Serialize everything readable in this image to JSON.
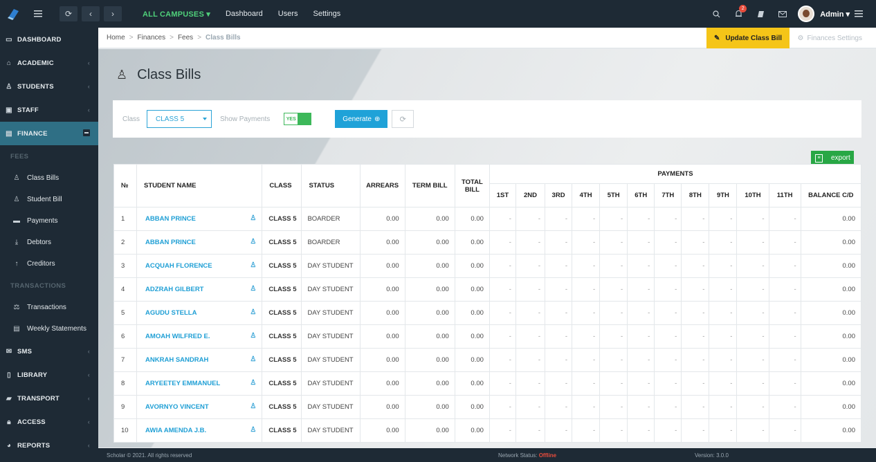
{
  "topbar": {
    "campus": "ALL CAMPUSES",
    "links": [
      "Dashboard",
      "Users",
      "Settings"
    ],
    "notif_count": "2",
    "user": "Admin"
  },
  "sidebar": {
    "items": [
      {
        "label": "DASHBOARD",
        "icon": "monitor-icon"
      },
      {
        "label": "ACADEMIC",
        "icon": "graduation-cap-icon"
      },
      {
        "label": "STUDENTS",
        "icon": "user-icon"
      },
      {
        "label": "STAFF",
        "icon": "briefcase-icon"
      },
      {
        "label": "FINANCE",
        "icon": "money-icon"
      }
    ],
    "fees_section": "FEES",
    "fees_items": [
      "Class Bills",
      "Student Bill",
      "Payments",
      "Debtors",
      "Creditors"
    ],
    "transactions_section": "TRANSACTIONS",
    "transactions_items": [
      "Transactions",
      "Weekly Statements"
    ],
    "bottom_items": [
      "SMS",
      "LIBRARY",
      "TRANSPORT",
      "ACCESS",
      "REPORTS"
    ]
  },
  "breadcrumb": [
    "Home",
    "Finances",
    "Fees",
    "Class Bills"
  ],
  "actions": {
    "update": "Update Class Bill",
    "settings": "Finances Settings"
  },
  "page": {
    "title": "Class Bills"
  },
  "filter": {
    "class_label": "Class",
    "class_value": "CLASS 5",
    "show_payments_label": "Show Payments",
    "toggle_value": "YES",
    "generate": "Generate"
  },
  "export": "export",
  "table": {
    "headers": {
      "no": "№",
      "name": "STUDENT NAME",
      "class": "CLASS",
      "status": "STATUS",
      "arrears": "ARREARS",
      "term": "TERM BILL",
      "total": "TOTAL BILL",
      "payments": "PAYMENTS",
      "balance": "BALANCE C/D"
    },
    "payment_cols": [
      "1ST",
      "2ND",
      "3RD",
      "4TH",
      "5TH",
      "6TH",
      "7TH",
      "8TH",
      "9TH",
      "10TH",
      "11TH"
    ],
    "rows": [
      {
        "no": "1",
        "name": "ABBAN PRINCE",
        "class": "CLASS 5",
        "status": "BOARDER",
        "arrears": "0.00",
        "term": "0.00",
        "total": "0.00",
        "balance": "0.00"
      },
      {
        "no": "2",
        "name": "ABBAN PRINCE",
        "class": "CLASS 5",
        "status": "BOARDER",
        "arrears": "0.00",
        "term": "0.00",
        "total": "0.00",
        "balance": "0.00"
      },
      {
        "no": "3",
        "name": "ACQUAH FLORENCE",
        "class": "CLASS 5",
        "status": "DAY STUDENT",
        "arrears": "0.00",
        "term": "0.00",
        "total": "0.00",
        "balance": "0.00"
      },
      {
        "no": "4",
        "name": "ADZRAH GILBERT",
        "class": "CLASS 5",
        "status": "DAY STUDENT",
        "arrears": "0.00",
        "term": "0.00",
        "total": "0.00",
        "balance": "0.00"
      },
      {
        "no": "5",
        "name": "AGUDU STELLA",
        "class": "CLASS 5",
        "status": "DAY STUDENT",
        "arrears": "0.00",
        "term": "0.00",
        "total": "0.00",
        "balance": "0.00"
      },
      {
        "no": "6",
        "name": "AMOAH WILFRED E.",
        "class": "CLASS 5",
        "status": "DAY STUDENT",
        "arrears": "0.00",
        "term": "0.00",
        "total": "0.00",
        "balance": "0.00"
      },
      {
        "no": "7",
        "name": "ANKRAH SANDRAH",
        "class": "CLASS 5",
        "status": "DAY STUDENT",
        "arrears": "0.00",
        "term": "0.00",
        "total": "0.00",
        "balance": "0.00"
      },
      {
        "no": "8",
        "name": "ARYEETEY EMMANUEL",
        "class": "CLASS 5",
        "status": "DAY STUDENT",
        "arrears": "0.00",
        "term": "0.00",
        "total": "0.00",
        "balance": "0.00"
      },
      {
        "no": "9",
        "name": "AVORNYO VINCENT",
        "class": "CLASS 5",
        "status": "DAY STUDENT",
        "arrears": "0.00",
        "term": "0.00",
        "total": "0.00",
        "balance": "0.00"
      },
      {
        "no": "10",
        "name": "AWIA AMENDA J.B.",
        "class": "CLASS 5",
        "status": "DAY STUDENT",
        "arrears": "0.00",
        "term": "0.00",
        "total": "0.00",
        "balance": "0.00"
      }
    ],
    "empty_cell": "-"
  },
  "footer": {
    "copyright": "Scholar © 2021. All rights reserved",
    "network_label": "Network Status:",
    "network_value": "Offline",
    "version": "Version: 3.0.0"
  },
  "colors": {
    "accent": "#1fa2d8",
    "sidebar_bg": "#1e2a35",
    "active": "#2f6f85",
    "update_btn": "#f5c518",
    "export": "#28a745",
    "offline": "#e74c3c"
  }
}
